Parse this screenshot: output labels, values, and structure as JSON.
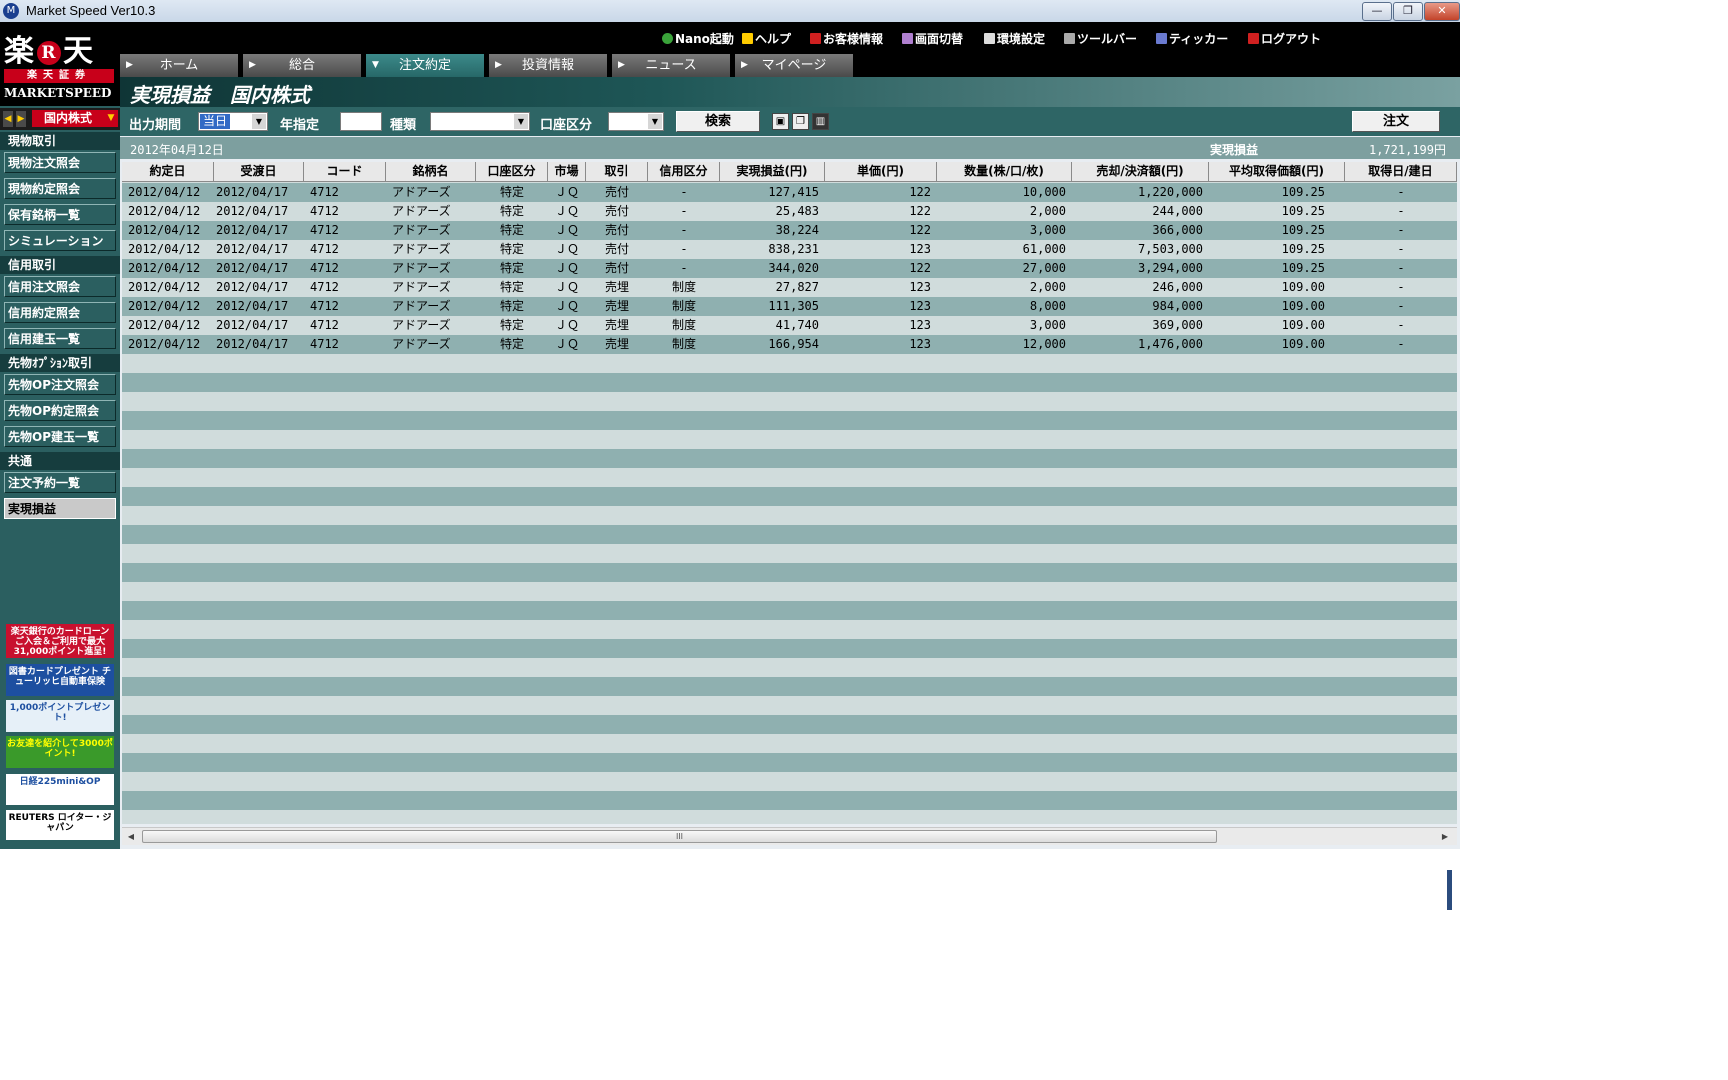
{
  "window": {
    "title": "Market Speed Ver10.3",
    "controls": [
      "—",
      "❐",
      "✕"
    ]
  },
  "brand": {
    "logo_main": [
      "楽",
      "R",
      "天"
    ],
    "logo_sub": "楽天証券",
    "product": "MARKETSPEED",
    "market_select": "国内株式"
  },
  "top_links": [
    {
      "label": "Nano起動",
      "icon": "nano-icon"
    },
    {
      "label": "ヘルプ",
      "icon": "help-icon"
    },
    {
      "label": "お客様情報",
      "icon": "customer-info-icon"
    },
    {
      "label": "画面切替",
      "icon": "screen-switch-icon"
    },
    {
      "label": "環境設定",
      "icon": "settings-icon"
    },
    {
      "label": "ツールバー",
      "icon": "toolbar-icon"
    },
    {
      "label": "ティッカー",
      "icon": "ticker-icon"
    },
    {
      "label": "ログアウト",
      "icon": "logout-icon"
    }
  ],
  "tabs": [
    {
      "label": "ホーム",
      "active": false
    },
    {
      "label": "総合",
      "active": false
    },
    {
      "label": "注文約定",
      "active": true
    },
    {
      "label": "投資情報",
      "active": false
    },
    {
      "label": "ニュース",
      "active": false
    },
    {
      "label": "マイページ",
      "active": false
    }
  ],
  "page_title": "実現損益　国内株式",
  "sidebar": {
    "sections": [
      {
        "heading": "現物取引",
        "items": [
          "現物注文照会",
          "現物約定照会",
          "保有銘柄一覧",
          "シミュレーション"
        ]
      },
      {
        "heading": "信用取引",
        "items": [
          "信用注文照会",
          "信用約定照会",
          "信用建玉一覧"
        ]
      },
      {
        "heading": "先物ｵﾌﾟｼｮﾝ取引",
        "items": [
          "先物OP注文照会",
          "先物OP約定照会",
          "先物OP建玉一覧"
        ]
      },
      {
        "heading": "共通",
        "items": [
          "注文予約一覧",
          "実現損益"
        ]
      }
    ],
    "active_item": "実現損益",
    "ads": [
      {
        "text": "楽天銀行のカードローン ご入会＆ご利用で最大31,000ポイント進呈!",
        "bg": "#c8102e",
        "fg": "#ffffff"
      },
      {
        "text": "図書カードプレゼント チューリッヒ自動車保険",
        "bg": "#1d4fa0",
        "fg": "#ffffff"
      },
      {
        "text": "1,000ポイントプレゼント!",
        "bg": "#e6f0f8",
        "fg": "#1d4fa0"
      },
      {
        "text": "お友達を紹介して3000ポイント!",
        "bg": "#3a9a2a",
        "fg": "#ffff00"
      },
      {
        "text": "日経225mini&OP",
        "bg": "#ffffff",
        "fg": "#1d4fa0"
      },
      {
        "text": "REUTERS ロイター・ジャパン",
        "bg": "#ffffff",
        "fg": "#000000"
      }
    ]
  },
  "toolbar": {
    "period_label": "出力期間",
    "period_value": "当日",
    "year_label": "年指定",
    "type_label": "種類",
    "account_label": "口座区分",
    "search_button": "検索",
    "order_button": "注文",
    "icons": [
      "save-icon",
      "copy-icon",
      "column-settings-icon"
    ]
  },
  "summary": {
    "date": "2012年04月12日",
    "pl_label": "実現損益",
    "pl_value": "1,721,199円"
  },
  "table": {
    "columns": [
      "約定日",
      "受渡日",
      "コード",
      "銘柄名",
      "口座区分",
      "市場",
      "取引",
      "信用区分",
      "実現損益(円)",
      "単価(円)",
      "数量(株/口/枚)",
      "売却/決済額(円)",
      "平均取得価額(円)",
      "取得日/建日"
    ],
    "rows": [
      [
        "2012/04/12",
        "2012/04/17",
        "4712",
        "アドアーズ",
        "特定",
        "ＪＱ",
        "売付",
        "-",
        "127,415",
        "122",
        "10,000",
        "1,220,000",
        "109.25",
        "-"
      ],
      [
        "2012/04/12",
        "2012/04/17",
        "4712",
        "アドアーズ",
        "特定",
        "ＪＱ",
        "売付",
        "-",
        "25,483",
        "122",
        "2,000",
        "244,000",
        "109.25",
        "-"
      ],
      [
        "2012/04/12",
        "2012/04/17",
        "4712",
        "アドアーズ",
        "特定",
        "ＪＱ",
        "売付",
        "-",
        "38,224",
        "122",
        "3,000",
        "366,000",
        "109.25",
        "-"
      ],
      [
        "2012/04/12",
        "2012/04/17",
        "4712",
        "アドアーズ",
        "特定",
        "ＪＱ",
        "売付",
        "-",
        "838,231",
        "123",
        "61,000",
        "7,503,000",
        "109.25",
        "-"
      ],
      [
        "2012/04/12",
        "2012/04/17",
        "4712",
        "アドアーズ",
        "特定",
        "ＪＱ",
        "売付",
        "-",
        "344,020",
        "122",
        "27,000",
        "3,294,000",
        "109.25",
        "-"
      ],
      [
        "2012/04/12",
        "2012/04/17",
        "4712",
        "アドアーズ",
        "特定",
        "ＪＱ",
        "売埋",
        "制度",
        "27,827",
        "123",
        "2,000",
        "246,000",
        "109.00",
        "-"
      ],
      [
        "2012/04/12",
        "2012/04/17",
        "4712",
        "アドアーズ",
        "特定",
        "ＪＱ",
        "売埋",
        "制度",
        "111,305",
        "123",
        "8,000",
        "984,000",
        "109.00",
        "-"
      ],
      [
        "2012/04/12",
        "2012/04/17",
        "4712",
        "アドアーズ",
        "特定",
        "ＪＱ",
        "売埋",
        "制度",
        "41,740",
        "123",
        "3,000",
        "369,000",
        "109.00",
        "-"
      ],
      [
        "2012/04/12",
        "2012/04/17",
        "4712",
        "アドアーズ",
        "特定",
        "ＪＱ",
        "売埋",
        "制度",
        "166,954",
        "123",
        "12,000",
        "1,476,000",
        "109.00",
        "-"
      ]
    ]
  },
  "scrollbar": {
    "grip": "III"
  }
}
